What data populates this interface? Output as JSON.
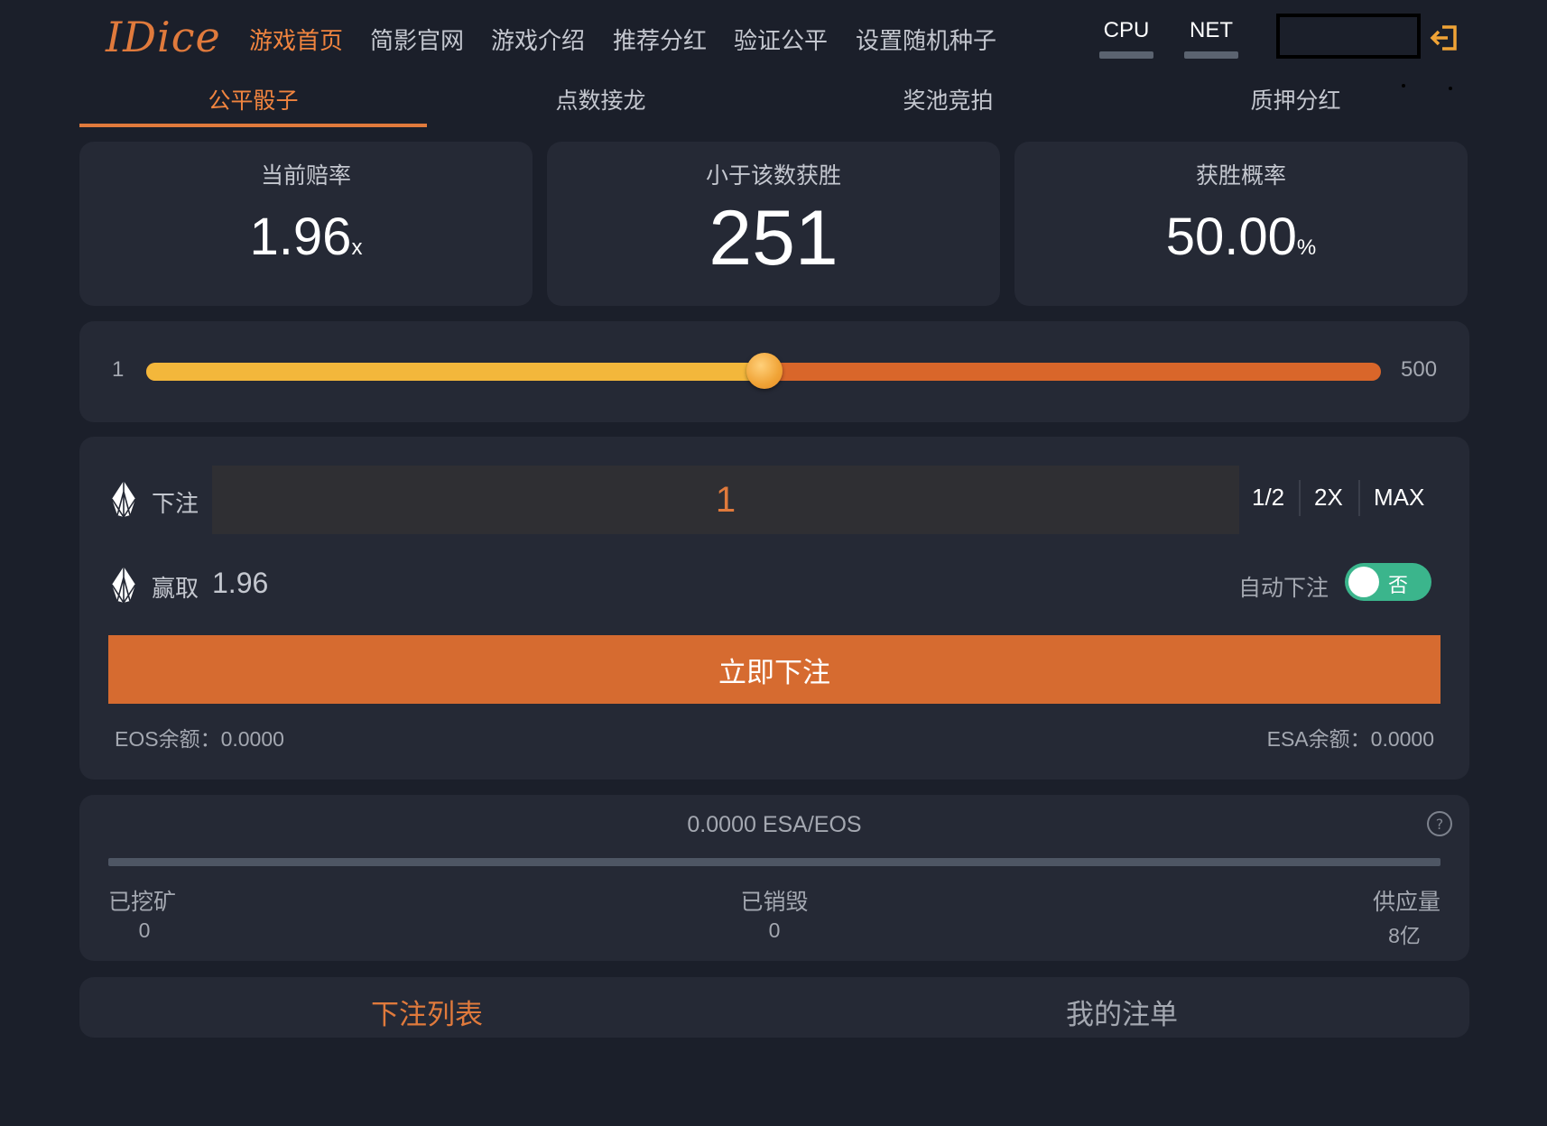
{
  "app": {
    "logo": "IDice"
  },
  "nav": {
    "items": [
      {
        "label": "游戏首页",
        "active": true
      },
      {
        "label": "简影官网",
        "active": false
      },
      {
        "label": "游戏介绍",
        "active": false
      },
      {
        "label": "推荐分红",
        "active": false
      },
      {
        "label": "验证公平",
        "active": false
      },
      {
        "label": "设置随机种子",
        "active": false
      }
    ],
    "resources": [
      {
        "label": "CPU"
      },
      {
        "label": "NET"
      }
    ],
    "logout_icon": "logout-icon"
  },
  "subtabs": [
    {
      "label": "公平骰子",
      "active": true
    },
    {
      "label": "点数接龙",
      "active": false
    },
    {
      "label": "奖池竞拍",
      "active": false
    },
    {
      "label": "质押分红",
      "active": false
    }
  ],
  "stats": {
    "odds": {
      "label": "当前赔率",
      "value": "1.96",
      "unit": "x"
    },
    "target": {
      "label": "小于该数获胜",
      "value": "251"
    },
    "probability": {
      "label": "获胜概率",
      "value": "50.00",
      "unit": "%"
    }
  },
  "slider": {
    "min": "1",
    "max": "500",
    "value": 251
  },
  "bet": {
    "label": "下注",
    "amount": "1",
    "quick": [
      "1/2",
      "2X",
      "MAX"
    ],
    "win_label": "赢取",
    "win_value": "1.96",
    "auto_label": "自动下注",
    "auto_state": "否",
    "button": "立即下注",
    "eos_balance": "EOS余额：0.0000",
    "esa_balance": "ESA余额：0.0000",
    "token_icon": "eos-icon"
  },
  "mining": {
    "rate": "0.0000 ESA/EOS",
    "progress": 0,
    "mined_label": "已挖矿",
    "mined_value": "0",
    "burned_label": "已销毁",
    "burned_value": "0",
    "supply_label": "供应量",
    "supply_value": "8亿",
    "help_icon": "question-icon"
  },
  "bottom_tabs": [
    {
      "label": "下注列表",
      "active": true
    },
    {
      "label": "我的注单",
      "active": false
    }
  ],
  "colors": {
    "accent": "#e07a3c",
    "button": "#d66b30",
    "slider_low": "#f3b73b",
    "slider_high": "#d9662a",
    "toggle": "#3bb58c",
    "background": "#1b1f2a",
    "card": "#252935"
  }
}
